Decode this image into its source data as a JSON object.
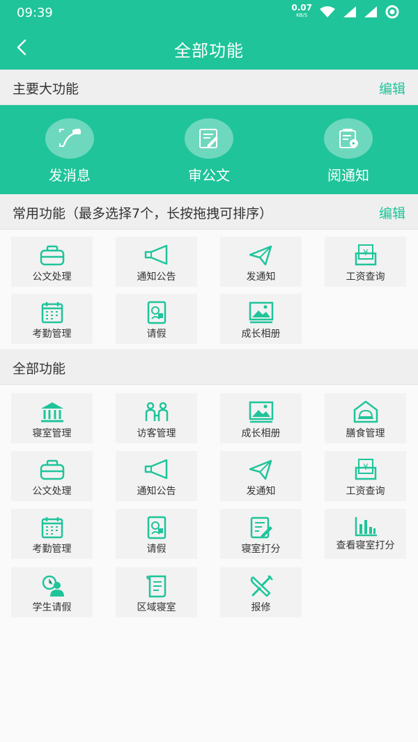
{
  "status": {
    "time": "09:39",
    "speed": "0.07",
    "speed_unit": "KB/S"
  },
  "header": {
    "title": "全部功能"
  },
  "main_section": {
    "label": "主要大功能",
    "edit": "编辑",
    "items": [
      {
        "label": "发消息",
        "icon": "message-icon"
      },
      {
        "label": "审公文",
        "icon": "document-review-icon"
      },
      {
        "label": "阅通知",
        "icon": "notice-icon"
      }
    ]
  },
  "common_section": {
    "label": "常用功能（最多选择7个，长按拖拽可排序）",
    "edit": "编辑",
    "items": [
      {
        "label": "公文处理",
        "icon": "briefcase-icon"
      },
      {
        "label": "通知公告",
        "icon": "megaphone-icon"
      },
      {
        "label": "发通知",
        "icon": "paper-plane-icon"
      },
      {
        "label": "工资查询",
        "icon": "salary-icon"
      },
      {
        "label": "考勤管理",
        "icon": "calendar-icon"
      },
      {
        "label": "请假",
        "icon": "leave-icon"
      },
      {
        "label": "成长相册",
        "icon": "photo-album-icon"
      }
    ]
  },
  "all_section": {
    "label": "全部功能",
    "items": [
      {
        "label": "寝室管理",
        "icon": "building-icon"
      },
      {
        "label": "访客管理",
        "icon": "visitors-icon"
      },
      {
        "label": "成长相册",
        "icon": "photo-album-icon"
      },
      {
        "label": "膳食管理",
        "icon": "meal-icon"
      },
      {
        "label": "公文处理",
        "icon": "briefcase-icon"
      },
      {
        "label": "通知公告",
        "icon": "megaphone-icon"
      },
      {
        "label": "发通知",
        "icon": "paper-plane-icon"
      },
      {
        "label": "工资查询",
        "icon": "salary-icon"
      },
      {
        "label": "考勤管理",
        "icon": "calendar-icon"
      },
      {
        "label": "请假",
        "icon": "leave-icon"
      },
      {
        "label": "寝室打分",
        "icon": "score-edit-icon"
      },
      {
        "label": "查看寝室打分",
        "icon": "bar-chart-icon"
      },
      {
        "label": "学生请假",
        "icon": "student-leave-icon"
      },
      {
        "label": "区域寝室",
        "icon": "scroll-icon"
      },
      {
        "label": "报修",
        "icon": "repair-tools-icon"
      }
    ]
  },
  "colors": {
    "accent": "#1fc49a",
    "section_bg": "#efefef",
    "tile_bg": "#f2f2f2"
  }
}
